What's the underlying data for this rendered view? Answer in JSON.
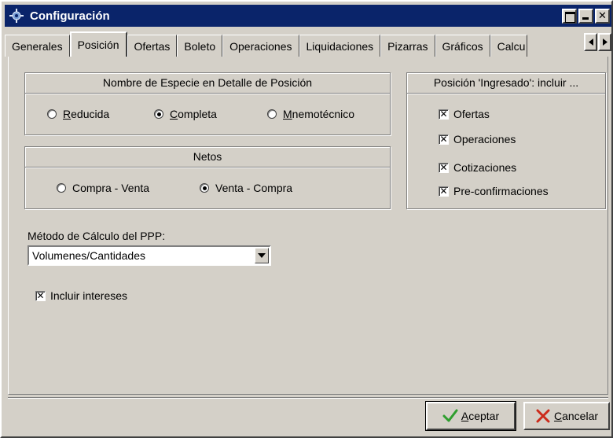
{
  "window": {
    "title": "Configuración",
    "icon": "gear-icon"
  },
  "tabs": [
    {
      "label": "Generales",
      "active": false
    },
    {
      "label": "Posición",
      "active": true
    },
    {
      "label": "Ofertas",
      "active": false
    },
    {
      "label": "Boleto",
      "active": false
    },
    {
      "label": "Operaciones",
      "active": false
    },
    {
      "label": "Liquidaciones",
      "active": false
    },
    {
      "label": "Pizarras",
      "active": false
    },
    {
      "label": "Gráficos",
      "active": false
    },
    {
      "label": "Calcu",
      "active": false
    }
  ],
  "especie_group": {
    "title": "Nombre de Especie en Detalle de Posición",
    "options": [
      {
        "mnemonic": "R",
        "rest": "educida",
        "selected": false
      },
      {
        "mnemonic": "C",
        "rest": "ompleta",
        "selected": true
      },
      {
        "mnemonic": "M",
        "rest": "nemotécnico",
        "selected": false
      }
    ]
  },
  "netos_group": {
    "title": "Netos",
    "options": [
      {
        "label": "Compra - Venta",
        "selected": false
      },
      {
        "label": "Venta - Compra",
        "selected": true
      }
    ]
  },
  "ingresado_group": {
    "title": "Posición 'Ingresado': incluir ...",
    "options": [
      {
        "label": "Ofertas",
        "checked": true
      },
      {
        "label": "Operaciones",
        "checked": true
      },
      {
        "label": "Cotizaciones",
        "checked": true
      },
      {
        "label": "Pre-confirmaciones",
        "checked": true
      }
    ]
  },
  "ppp": {
    "label": "Método de Cálculo del PPP:",
    "value": "Volumenes/Cantidades"
  },
  "intereses": {
    "label": "Incluir intereses",
    "checked": true
  },
  "buttons": {
    "accept": {
      "mnemonic": "A",
      "rest": "ceptar"
    },
    "cancel": {
      "mnemonic": "C",
      "rest": "ancelar"
    }
  },
  "colors": {
    "titlebar": "#0a246a",
    "face": "#d4d0c8",
    "accept_check": "#2e9e2e",
    "cancel_x": "#cc2a1a"
  }
}
